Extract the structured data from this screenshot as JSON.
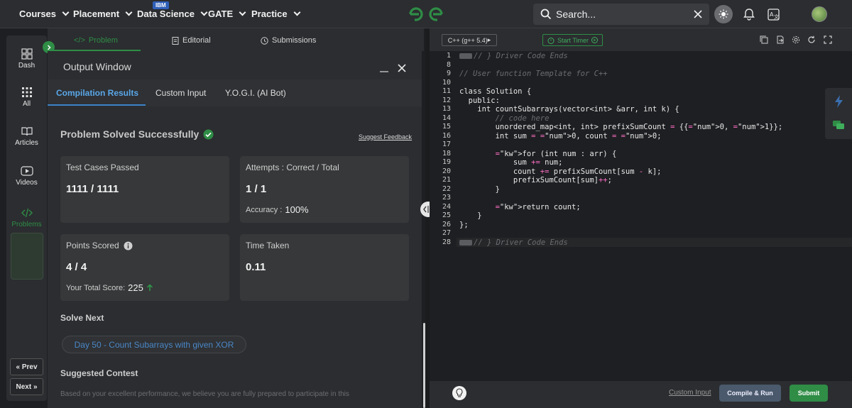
{
  "topbar": {
    "nav": [
      {
        "label": "Courses"
      },
      {
        "label": "Placement"
      },
      {
        "label": "Data Science"
      },
      {
        "label": "GATE"
      },
      {
        "label": "Practice"
      }
    ],
    "ibm_badge": "IBM",
    "search_placeholder": "Search..."
  },
  "sidebar": {
    "items": [
      {
        "label": "Dash",
        "icon": "dashboard-icon"
      },
      {
        "label": "All",
        "icon": "grid-icon"
      },
      {
        "label": "Articles",
        "icon": "book-icon"
      },
      {
        "label": "Videos",
        "icon": "video-icon"
      },
      {
        "label": "Problems",
        "icon": "code-icon"
      }
    ],
    "prev_label": "Prev",
    "next_label": "Next"
  },
  "problem_tabs": [
    {
      "label": "Problem",
      "active": true
    },
    {
      "label": "Editorial",
      "active": false
    },
    {
      "label": "Submissions",
      "active": false
    }
  ],
  "output": {
    "title": "Output Window",
    "tabs": [
      {
        "label": "Compilation Results",
        "active": true
      },
      {
        "label": "Custom Input",
        "active": false
      },
      {
        "label": "Y.O.G.I. (AI Bot)",
        "active": false
      }
    ],
    "status": "Problem Solved Successfully",
    "feedback_link": "Suggest Feedback",
    "cards": {
      "tests": {
        "label": "Test Cases Passed",
        "value": "1111 / 1111"
      },
      "attempts": {
        "label": "Attempts : Correct / Total",
        "value": "1 / 1",
        "sub_label": "Accuracy :",
        "sub_value": "100%"
      },
      "points": {
        "label": "Points Scored",
        "value": "4 / 4",
        "sub_label": "Your Total Score:",
        "sub_value": "225"
      },
      "time": {
        "label": "Time Taken",
        "value": "0.11"
      }
    },
    "solve_next_heading": "Solve Next",
    "solve_next_item": "Day 50 - Count Subarrays with given XOR",
    "contest_heading": "Suggested Contest",
    "contest_text": "Based on your excellent performance, we believe you are fully prepared to participate in this"
  },
  "editor": {
    "language": "C++ (g++ 5.4)",
    "timer_label": "Start Timer",
    "lines": [
      {
        "n": "1",
        "code": "// } Driver Code Ends"
      },
      {
        "n": "8",
        "code": ""
      },
      {
        "n": "9",
        "code": "// User function Template for C++"
      },
      {
        "n": "10",
        "code": ""
      },
      {
        "n": "11",
        "code": "class Solution {"
      },
      {
        "n": "12",
        "code": "  public:"
      },
      {
        "n": "13",
        "code": "    int countSubarrays(vector<int> &arr, int k) {"
      },
      {
        "n": "14",
        "code": "        // code here"
      },
      {
        "n": "15",
        "code": "        unordered_map<int, int> prefixSumCount = {{0, 1}};"
      },
      {
        "n": "16",
        "code": "        int sum = 0, count = 0;"
      },
      {
        "n": "17",
        "code": ""
      },
      {
        "n": "18",
        "code": "        for (int num : arr) {"
      },
      {
        "n": "19",
        "code": "            sum += num;"
      },
      {
        "n": "20",
        "code": "            count += prefixSumCount[sum - k];"
      },
      {
        "n": "21",
        "code": "            prefixSumCount[sum]++;"
      },
      {
        "n": "22",
        "code": "        }"
      },
      {
        "n": "23",
        "code": ""
      },
      {
        "n": "24",
        "code": "        return count;"
      },
      {
        "n": "25",
        "code": "    }"
      },
      {
        "n": "26",
        "code": "};"
      },
      {
        "n": "27",
        "code": ""
      },
      {
        "n": "28",
        "code": "// } Driver Code Ends"
      }
    ],
    "custom_input": "Custom Input",
    "compile_label": "Compile & Run",
    "submit_label": "Submit"
  },
  "colors": {
    "brand_green": "#2f8d46",
    "accent_blue": "#3b82c8",
    "background": "#1e1f22"
  }
}
